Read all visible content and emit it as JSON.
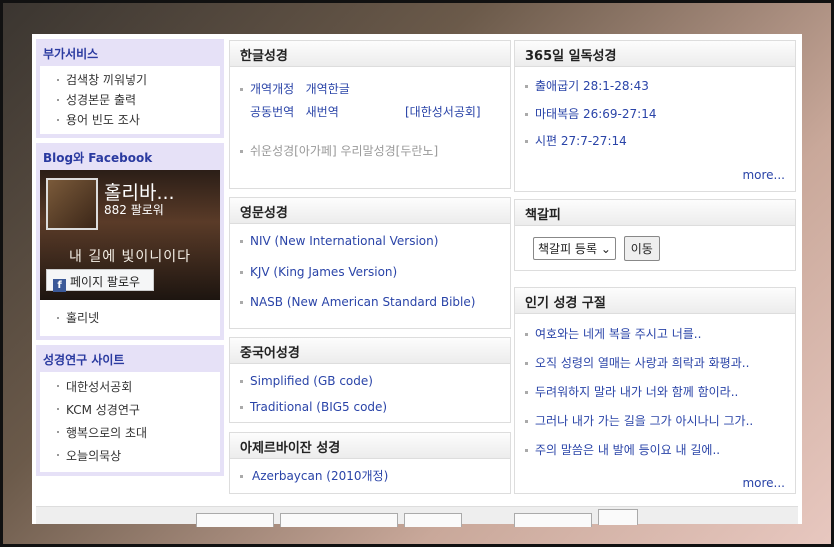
{
  "left": {
    "services": {
      "title": "부가서비스",
      "items": [
        "검색창 끼워넣기",
        "성경본문 출력",
        "용어 빈도 조사"
      ]
    },
    "blog": {
      "title": "Blog와 Facebook",
      "card_name": "홀리바...",
      "card_followers": "882 팔로워",
      "card_art_text": "내 길에 빛이니이다",
      "follow_button": "페이지 팔로우",
      "link": "홀리넷"
    },
    "research": {
      "title": "성경연구 사이트",
      "items": [
        "대한성서공회",
        "KCM 성경연구",
        "행복으로의 초대",
        "오늘의묵상"
      ]
    }
  },
  "korean": {
    "title": "한글성경",
    "row1": [
      "개역개정",
      "개역한글"
    ],
    "row2": [
      "공동번역",
      "새번역"
    ],
    "row2_right": "[대한성서공회]",
    "row3": "쉬운성경[아가페]   우리말성경[두란노]"
  },
  "english": {
    "title": "영문성경",
    "items": [
      "NIV (New International Version)",
      "KJV (King James Version)",
      "NASB (New American Standard Bible)"
    ]
  },
  "chinese": {
    "title": "중국어성경",
    "items": [
      "Simplified (GB code)",
      "Traditional (BIG5 code)"
    ]
  },
  "azerbaijani": {
    "title": "아제르바이잔 성경",
    "items": [
      "Azerbaycan (2010개정)"
    ]
  },
  "reading365": {
    "title": "365일 일독성경",
    "items": [
      "출애굽기 28:1-28:43",
      "마태복음 26:69-27:14",
      "시편 27:7-27:14"
    ],
    "more": "more..."
  },
  "bookmark": {
    "title": "책갈피",
    "select_value": "책갈피 등록",
    "go_button": "이동"
  },
  "popular": {
    "title": "인기 성경 구절",
    "items": [
      "여호와는 네게 복을 주시고 너를..",
      "오직 성령의 열매는 사랑과 희락과 화평과..",
      "두려워하지 말라 내가 너와 함께 함이라..",
      "그러나 내가 가는 길을 그가 아시나니 그가..",
      "주의 말씀은 내 발에 등이요 내 길에.."
    ],
    "more": "more..."
  }
}
